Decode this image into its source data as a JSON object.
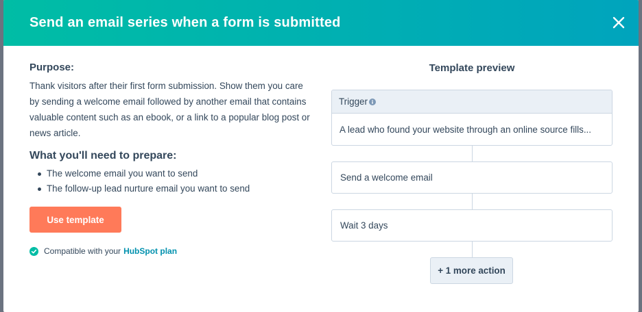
{
  "modal": {
    "title": "Send an email series when a form is submitted",
    "close_icon": "close-icon"
  },
  "purpose": {
    "heading": "Purpose:",
    "text": "Thank visitors after their first form submission. Show them you care by sending a welcome email followed by another email that contains valuable content such as an ebook, or a link to a popular blog post or news article."
  },
  "prepare": {
    "heading": "What you'll need to prepare:",
    "items": [
      "The welcome email you want to send",
      "The follow-up lead nurture email you want to send"
    ]
  },
  "use_template_label": "Use template",
  "compatibility": {
    "text": "Compatible with your",
    "link": "HubSpot plan",
    "icon": "check-circle-icon",
    "color": "#00bda5"
  },
  "preview": {
    "title": "Template preview",
    "trigger": {
      "label": "Trigger",
      "icon": "info-icon",
      "text": "A lead who found your website through an online source fills..."
    },
    "actions": [
      {
        "label": "Send a welcome email"
      },
      {
        "label": "Wait 3 days"
      }
    ],
    "more_actions_label": "+ 1 more action"
  },
  "colors": {
    "header_gradient_start": "#00bda5",
    "header_gradient_end": "#00a4bd",
    "primary_button": "#ff7a59",
    "text": "#33475b",
    "link": "#0091ae",
    "border": "#cbd6e2",
    "panel_bg": "#eaf0f6"
  }
}
